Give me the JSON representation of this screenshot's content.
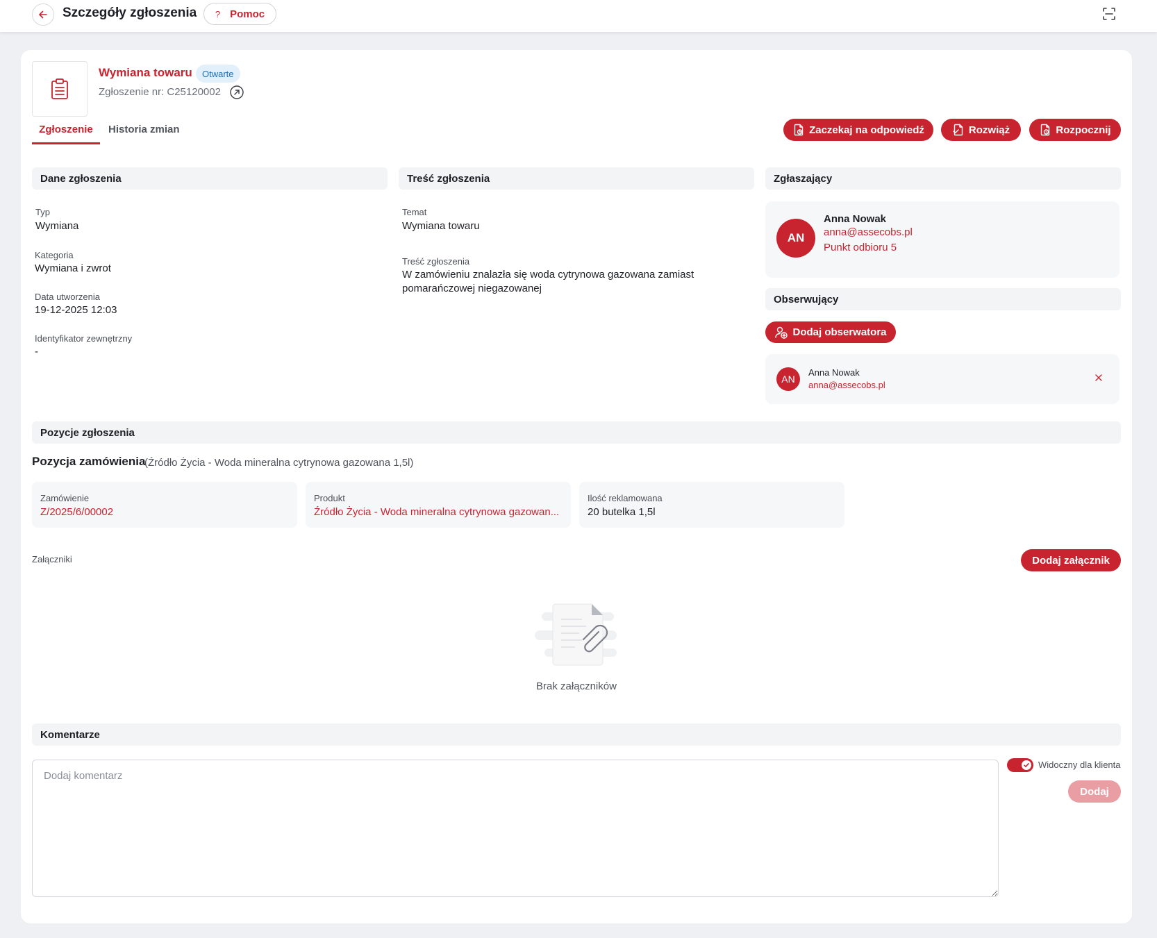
{
  "header": {
    "title": "Szczegóły zgłoszenia",
    "help_label": "Pomoc",
    "help_glyph": "?"
  },
  "ticket": {
    "title": "Wymiana towaru",
    "status": "Otwarte",
    "number": "Zgłoszenie nr: C25120002"
  },
  "tabs": [
    {
      "label": "Zgłoszenie",
      "active": true
    },
    {
      "label": "Historia zmian",
      "active": false
    }
  ],
  "actions": {
    "wait": "Zaczekaj na odpowiedź",
    "resolve": "Rozwiąż",
    "start": "Rozpocznij"
  },
  "details": {
    "header": "Dane zgłoszenia",
    "fields": [
      {
        "label": "Typ",
        "value": "Wymiana"
      },
      {
        "label": "Kategoria",
        "value": "Wymiana i zwrot"
      },
      {
        "label": "Data utworzenia",
        "value": "19-12-2025 12:03"
      },
      {
        "label": "Identyfikator zewnętrzny",
        "value": "-"
      }
    ]
  },
  "content": {
    "header": "Treść zgłoszenia",
    "subject_label": "Temat",
    "subject": "Wymiana towaru",
    "body_label": "Treść zgłoszenia",
    "body_line1": "W zamówieniu znalazła się woda cytrynowa gazowana zamiast",
    "body_line2": "pomarańczowej niegazowanej"
  },
  "requester": {
    "header": "Zgłaszający",
    "initials": "AN",
    "name": "Anna Nowak",
    "email": "anna@assecobs.pl",
    "pickup_point": "Punkt odbioru 5"
  },
  "observers": {
    "header": "Obserwujący",
    "add_label": "Dodaj obserwatora",
    "items": [
      {
        "initials": "AN",
        "name": "Anna Nowak",
        "email": "anna@assecobs.pl"
      }
    ]
  },
  "positions": {
    "header": "Pozycje zgłoszenia",
    "title": "Pozycja zamówienia",
    "subtitle": "(Źródło Życia - Woda mineralna cytrynowa gazowana 1,5l)",
    "cards": [
      {
        "label": "Zamówienie",
        "value": "Z/2025/6/00002"
      },
      {
        "label": "Produkt",
        "value": "Źródło Życia - Woda mineralna cytrynowa gazowan..."
      },
      {
        "label": "Ilość reklamowana",
        "value": "20 butelka 1,5l"
      }
    ]
  },
  "attachments": {
    "label": "Załączniki",
    "add_label": "Dodaj załącznik",
    "empty_text": "Brak załączników"
  },
  "comments": {
    "header": "Komentarze",
    "placeholder": "Dodaj komentarz",
    "visible_label": "Widoczny dla klienta",
    "visible_to_client": true,
    "add_label": "Dodaj"
  },
  "colors": {
    "accent": "#c8242f",
    "status_bg": "#e2f0fb",
    "status_text": "#1e6fb5",
    "section_bg": "#f3f4f6",
    "page_bg": "#eef0f3"
  },
  "icons": {
    "back": "arrow-left-icon",
    "fullscreen": "fullscreen-icon",
    "ticket": "clipboard-icon",
    "external": "external-link-icon",
    "wait": "file-clock-icon",
    "resolve": "file-check-icon",
    "start": "file-play-icon",
    "add_observer": "user-add-icon",
    "remove": "close-icon",
    "empty": "attachment-placeholder-icon"
  }
}
